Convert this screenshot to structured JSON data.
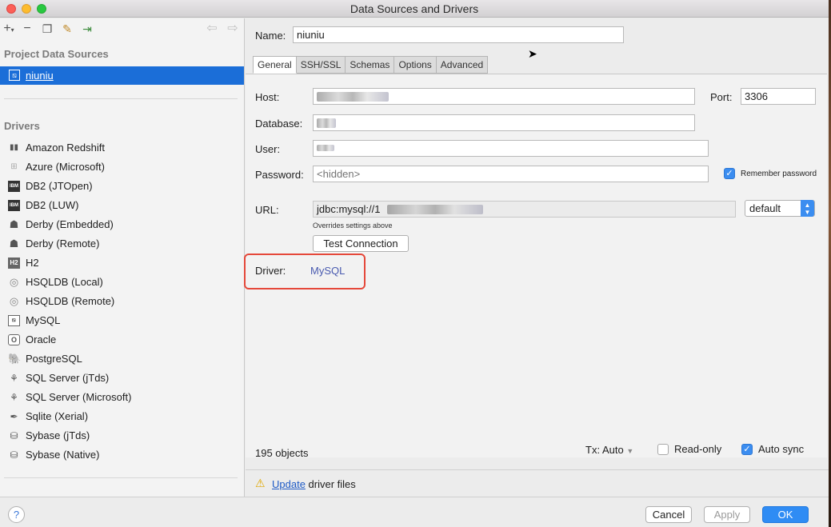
{
  "window": {
    "title": "Data Sources and Drivers"
  },
  "left": {
    "project_title": "Project Data Sources",
    "data_source": "niuniu",
    "drivers_title": "Drivers",
    "drivers": [
      "Amazon Redshift",
      "Azure (Microsoft)",
      "DB2 (JTOpen)",
      "DB2 (LUW)",
      "Derby (Embedded)",
      "Derby (Remote)",
      "H2",
      "HSQLDB (Local)",
      "HSQLDB (Remote)",
      "MySQL",
      "Oracle",
      "PostgreSQL",
      "SQL Server (jTds)",
      "SQL Server (Microsoft)",
      "Sqlite (Xerial)",
      "Sybase (jTds)",
      "Sybase (Native)"
    ]
  },
  "form": {
    "name_label": "Name:",
    "name_value": "niuniu",
    "tabs": [
      "General",
      "SSH/SSL",
      "Schemas",
      "Options",
      "Advanced"
    ],
    "host_label": "Host:",
    "port_label": "Port:",
    "port_value": "3306",
    "database_label": "Database:",
    "user_label": "User:",
    "password_label": "Password:",
    "password_placeholder": "<hidden>",
    "remember_password": "Remember password",
    "url_label": "URL:",
    "url_value": "jdbc:mysql://1",
    "url_mode": "default",
    "overrides_note": "Overrides settings above",
    "test_connection": "Test Connection",
    "driver_label": "Driver:",
    "driver_value": "MySQL"
  },
  "status": {
    "objects": "195 objects",
    "tx": "Tx: Auto",
    "readonly": "Read-only",
    "autosync": "Auto sync"
  },
  "update_bar": {
    "link": "Update",
    "text": " driver files"
  },
  "dialog": {
    "help": "?",
    "cancel": "Cancel",
    "apply": "Apply",
    "ok": "OK"
  }
}
